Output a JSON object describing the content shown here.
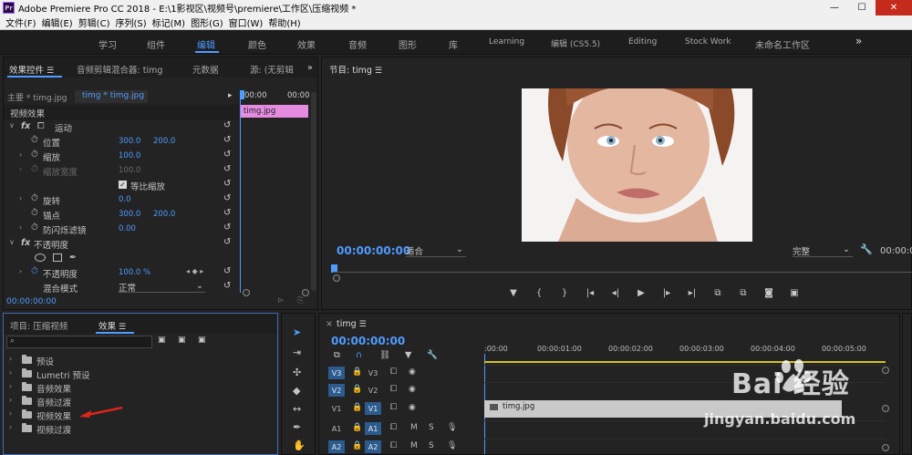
{
  "window": {
    "title": "Adobe Premiere Pro CC 2018 - E:\\1影视区\\视频号\\premiere\\工作区\\压缩视频 *",
    "logo": "Pr",
    "minimize": "—",
    "maximize": "☐",
    "close": "✕"
  },
  "menu": [
    "文件(F)",
    "编辑(E)",
    "剪辑(C)",
    "序列(S)",
    "标记(M)",
    "图形(G)",
    "窗口(W)",
    "帮助(H)"
  ],
  "workspaces": {
    "items": [
      "学习",
      "组件",
      "编辑",
      "颜色",
      "效果",
      "音频",
      "图形",
      "库",
      "Learning",
      "编辑 (CS5.5)",
      "Editing",
      "Stock Work",
      "未命名工作区"
    ],
    "active": "编辑",
    "more": "»"
  },
  "effect_controls": {
    "tabs": [
      "效果控件",
      "音频剪辑混合器: timg",
      "元数据",
      "源: (无剪辑"
    ],
    "master": "主要 * timg.jpg",
    "clip": "timg * timg.jpg",
    "ruler": [
      "00:00",
      "00:00"
    ],
    "section_video": "视频效果",
    "clip_name": "timg.jpg",
    "rows": [
      {
        "label": "运动",
        "fx": true
      },
      {
        "label": "位置",
        "v1": "300.0",
        "v2": "200.0"
      },
      {
        "label": "缩放",
        "v1": "100.0"
      },
      {
        "label": "缩放宽度",
        "v1": "100.0",
        "disabled": true
      },
      {
        "label": "等比缩放",
        "checkbox": true
      },
      {
        "label": "旋转",
        "v1": "0.0"
      },
      {
        "label": "锚点",
        "v1": "300.0",
        "v2": "200.0"
      },
      {
        "label": "防闪烁滤镜",
        "v1": "0.00"
      },
      {
        "label": "不透明度",
        "fx": true
      },
      {
        "label": "不透明度",
        "v1": "100.0 %"
      },
      {
        "label": "混合模式",
        "select": "正常"
      }
    ],
    "timecode": "00:00:00:00"
  },
  "program_monitor": {
    "title": "节目: timg",
    "timecode": "00:00:00:00",
    "fit": "适合",
    "quality": "完整",
    "duration": "00:00:0",
    "controls": [
      "▼",
      "{",
      "}",
      "|◂",
      "◂|",
      "▶",
      "|▸",
      "▸|",
      "⧉",
      "⧉",
      "◙",
      "▣"
    ]
  },
  "project": {
    "tabs": [
      "项目: 压缩视频",
      "效果"
    ],
    "items": [
      "预设",
      "Lumetri 预设",
      "音频效果",
      "音频过渡",
      "视频效果",
      "视频过渡"
    ]
  },
  "timeline": {
    "tab": "timg",
    "timecode": "00:00:00:00",
    "ruler": [
      ":00:00",
      "00:00:01:00",
      "00:00:02:00",
      "00:00:03:00",
      "00:00:04:00",
      "00:00:05:00"
    ],
    "tracks": [
      {
        "src": "V3",
        "name": "V3"
      },
      {
        "src": "V2",
        "name": "V2"
      },
      {
        "src": "V1",
        "name": "V1"
      },
      {
        "src": "A1",
        "name": "A1"
      },
      {
        "src": "A2",
        "name": "A2"
      }
    ],
    "clip": "timg.jpg"
  },
  "watermark": {
    "brand": "Bai  经验",
    "url": "jingyan.baidu.com"
  },
  "colors": {
    "accent": "#4f9bff",
    "clip_pink": "#e58ce0",
    "work_area": "#d6c21a"
  }
}
